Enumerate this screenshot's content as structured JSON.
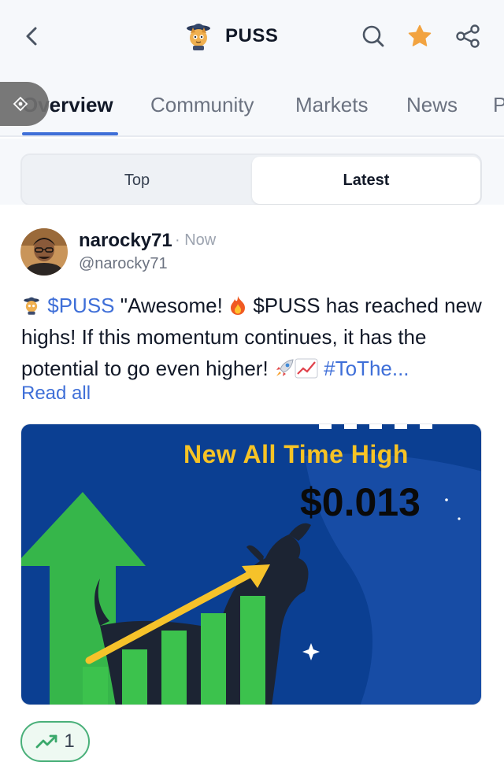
{
  "header": {
    "title": "PUSS",
    "back_icon": "chevron-left-icon",
    "search_icon": "search-icon",
    "favorite_icon": "star-icon",
    "share_icon": "share-icon",
    "accent_color": "#f2a340"
  },
  "tabs": [
    {
      "label": "Overview",
      "active": true
    },
    {
      "label": "Community",
      "active": false
    },
    {
      "label": "Markets",
      "active": false
    },
    {
      "label": "News",
      "active": false
    },
    {
      "label": "P",
      "active": false
    }
  ],
  "segment": {
    "options": [
      "Top",
      "Latest"
    ],
    "selected": "Latest"
  },
  "post": {
    "username": "narocky71",
    "time": "· Now",
    "handle": "@narocky71",
    "text": {
      "ticker1": "$PUSS",
      "part1": " \"Awesome! ",
      "part2": " $PUSS has reached new highs! If this momentum continues, it has the potential to go even higher! ",
      "hashtag": "#ToThe..."
    },
    "read_all": "Read all",
    "image": {
      "headline": "New All Time High",
      "price": "$0.013"
    },
    "reaction": {
      "icon": "trending-up-icon",
      "count": "1"
    }
  },
  "colors": {
    "link": "#3f6fd8",
    "tab_underline": "#3f6fd8",
    "reaction_border": "#4ab07a",
    "image_bg": "#0b3f92",
    "headline": "#f7c325"
  }
}
